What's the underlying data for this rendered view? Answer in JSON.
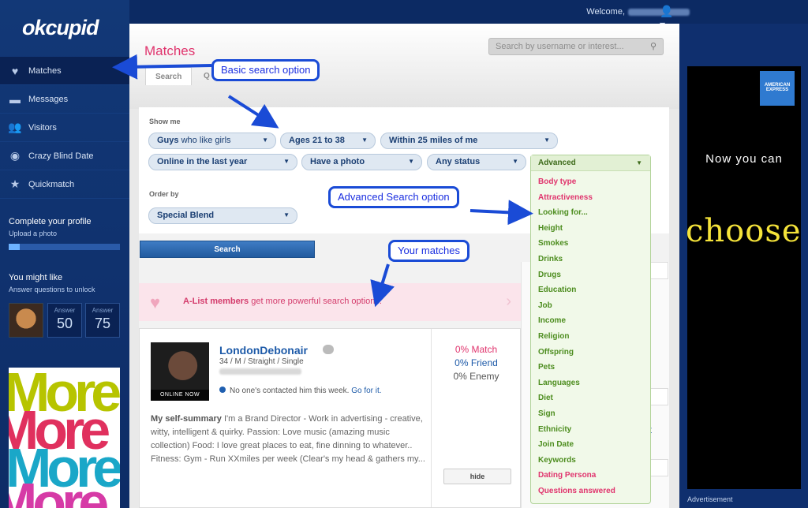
{
  "header": {
    "welcome": "Welcome,",
    "user_icon": "user-icon"
  },
  "sidebar": {
    "logo": "okcupid",
    "items": [
      {
        "label": "Matches",
        "icon": "heart-icon"
      },
      {
        "label": "Messages",
        "icon": "chat-icon"
      },
      {
        "label": "Visitors",
        "icon": "people-icon"
      },
      {
        "label": "Crazy Blind Date",
        "icon": "eye-icon"
      },
      {
        "label": "Quickmatch",
        "icon": "star-icon"
      }
    ],
    "complete_title": "Complete your profile",
    "complete_sub": "Upload a photo",
    "profile_progress": 0.1,
    "you_might_like": "You might like",
    "answer_hint": "Answer questions to unlock",
    "answer_label": "Answer",
    "answer_values": [
      "50",
      "75"
    ]
  },
  "main": {
    "title": "Matches",
    "search_placeholder": "Search by username or interest...",
    "tabs": [
      "Search",
      "Q"
    ],
    "show_me": "Show me",
    "order_by": "Order by",
    "filters": {
      "who_bold": "Guys",
      "who_light": "who like girls",
      "ages": "Ages 21 to 38",
      "distance": "Within 25 miles of me",
      "online": "Online in the last year",
      "photo": "Have a photo",
      "status": "Any status",
      "advanced": "Advanced",
      "order": "Special Blend"
    },
    "search_button": "Search",
    "alist_bold": "A-List members",
    "alist_text": "get more powerful search options."
  },
  "match": {
    "username": "LondonDebonair",
    "meta": "34 / M / Straight / Single",
    "online": "ONLINE NOW",
    "contacted": "No one's contacted him this week.",
    "go": "Go for it.",
    "summary_label": "My self-summary",
    "summary_text": "I'm a Brand Director - Work in advertising - creative, witty, intelligent & quirky. Passion: Love music (amazing music collection) Food: I love great places to eat, fine dinning to whatever.. Fitness: Gym - Run XXmiles per week (Clear's my head & gathers my...",
    "match_pct": "0% Match",
    "friend_pct": "0% Friend",
    "enemy_pct": "0% Enemy",
    "hide": "hide"
  },
  "advanced_menu": {
    "items": [
      {
        "label": "Body type",
        "color": "red"
      },
      {
        "label": "Attractiveness",
        "color": "red"
      },
      {
        "label": "Looking for...",
        "color": "green"
      },
      {
        "label": "Height",
        "color": "green"
      },
      {
        "label": "Smokes",
        "color": "green"
      },
      {
        "label": "Drinks",
        "color": "green"
      },
      {
        "label": "Drugs",
        "color": "green"
      },
      {
        "label": "Education",
        "color": "green"
      },
      {
        "label": "Job",
        "color": "green"
      },
      {
        "label": "Income",
        "color": "green"
      },
      {
        "label": "Religion",
        "color": "green"
      },
      {
        "label": "Offspring",
        "color": "green"
      },
      {
        "label": "Pets",
        "color": "green"
      },
      {
        "label": "Languages",
        "color": "green"
      },
      {
        "label": "Diet",
        "color": "green"
      },
      {
        "label": "Sign",
        "color": "green"
      },
      {
        "label": "Ethnicity",
        "color": "green"
      },
      {
        "label": "Join Date",
        "color": "green"
      },
      {
        "label": "Keywords",
        "color": "green"
      },
      {
        "label": "Dating Persona",
        "color": "red"
      },
      {
        "label": "Questions answered",
        "color": "red"
      }
    ]
  },
  "right_col_fragments": [
    "nt"
  ],
  "ad": {
    "now_you_can": "Now you can",
    "choose": "choose",
    "amex": "AMERICAN EXPRESS",
    "advertisement": "Advertisement",
    "left_ad_word": "More"
  },
  "annotations": {
    "basic": "Basic search option",
    "advanced": "Advanced Search option",
    "matches": "Your matches"
  },
  "colors": {
    "brand_blue": "#0f2f6e",
    "accent_pink": "#e0346d",
    "link_blue": "#1d5aa8",
    "advanced_green": "#4d8d1f",
    "annotation_blue": "#1a4bd6"
  }
}
